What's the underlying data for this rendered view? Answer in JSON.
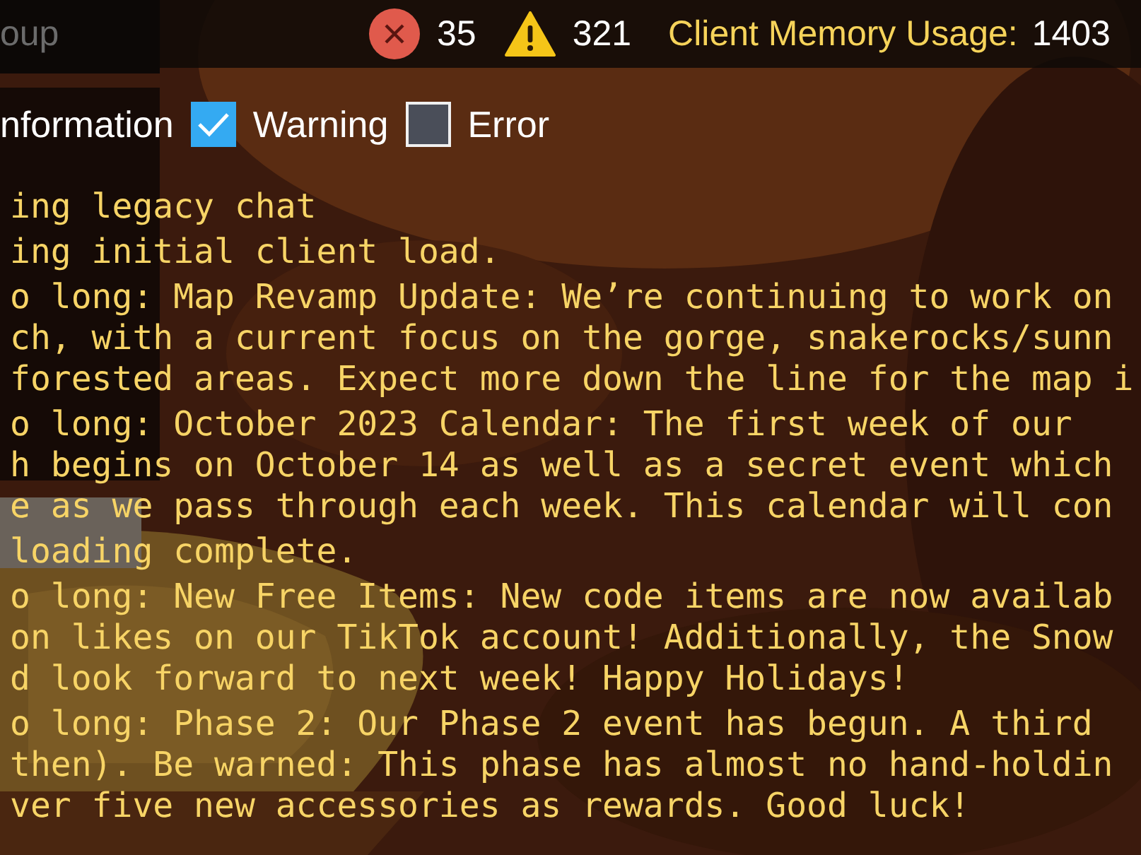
{
  "filter_field": {
    "text": "oup"
  },
  "counts": {
    "errors": "35",
    "warnings": "321"
  },
  "memory": {
    "label": "Client Memory Usage:",
    "value": "1403"
  },
  "information_label": "nformation",
  "filters": [
    {
      "label": "Warning",
      "checked": true
    },
    {
      "label": "Error",
      "checked": false
    }
  ],
  "log": [
    {
      "lines": [
        "ing legacy chat"
      ]
    },
    {
      "lines": [
        "ing initial client load."
      ]
    },
    {
      "lines": [
        "o long: Map Revamp Update: We’re continuing to work on",
        "ch, with a current focus on the gorge, snakerocks/sunn",
        "forested areas. Expect more down the line for the map i"
      ]
    },
    {
      "lines": [
        "o long: October 2023 Calendar: The first week of our",
        "h begins on October 14 as well as a secret event which",
        "e as we pass through each week. This calendar will con"
      ]
    },
    {
      "lines": [
        "loading complete."
      ]
    },
    {
      "lines": [
        "o long: New Free Items: New code items are now availab",
        "on likes on our TikTok account! Additionally, the Snow",
        "d look forward to next week! Happy Holidays!"
      ]
    },
    {
      "lines": [
        "o long: Phase 2: Our Phase 2 event has begun. A third",
        "then). Be warned: This phase has almost no hand-holdin",
        "ver five new accessories as rewards. Good luck!"
      ]
    }
  ]
}
